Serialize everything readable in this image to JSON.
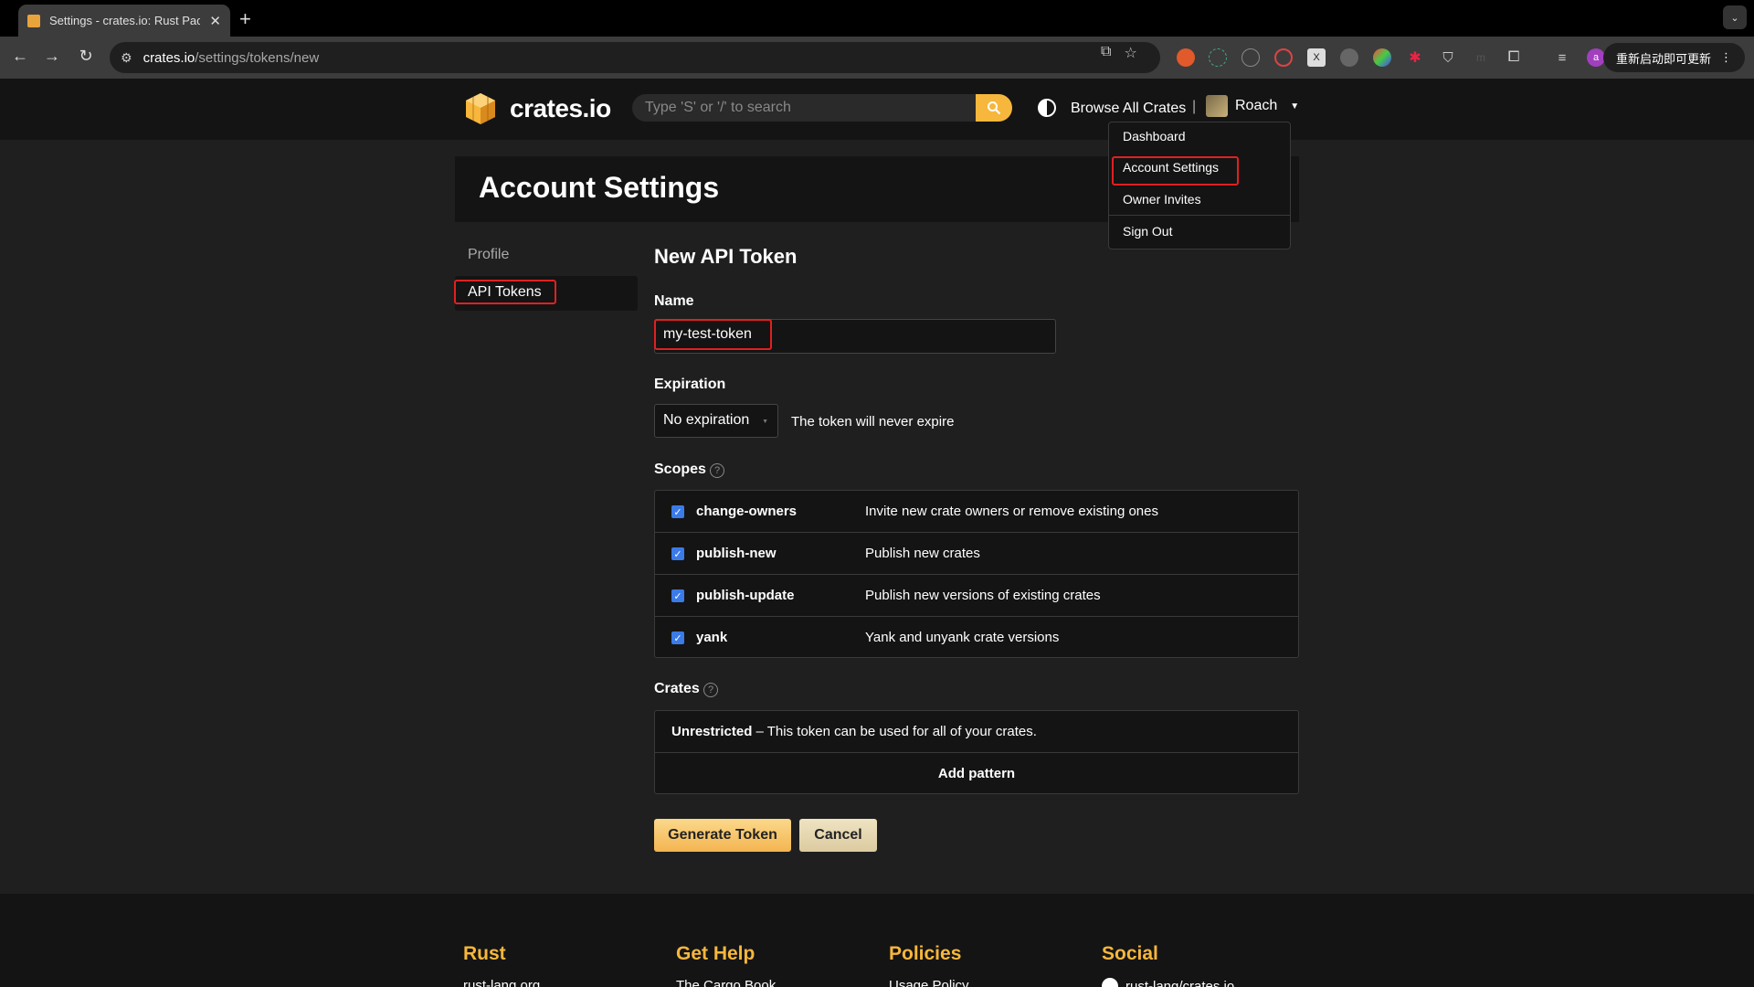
{
  "browser": {
    "tab_title": "Settings - crates.io: Rust Package Registry",
    "url_host": "crates.io",
    "url_path": "/settings/tokens/new",
    "update_label": "重新启动即可更新"
  },
  "header": {
    "logo_text": "crates.io",
    "search_placeholder": "Type 'S' or '/' to search",
    "browse_label": "Browse All Crates",
    "separator": "|",
    "username": "Roach"
  },
  "dropdown": {
    "items": [
      "Dashboard",
      "Account Settings",
      "Owner Invites",
      "Sign Out"
    ]
  },
  "page": {
    "title": "Account Settings"
  },
  "sidebar": {
    "items": [
      "Profile",
      "API Tokens"
    ]
  },
  "form": {
    "title": "New API Token",
    "name_label": "Name",
    "name_value": "my-test-token",
    "expiration_label": "Expiration",
    "expiration_value": "No expiration",
    "expiration_note": "The token will never expire",
    "scopes_label": "Scopes",
    "scopes": [
      {
        "name": "change-owners",
        "desc": "Invite new crate owners or remove existing ones"
      },
      {
        "name": "publish-new",
        "desc": "Publish new crates"
      },
      {
        "name": "publish-update",
        "desc": "Publish new versions of existing crates"
      },
      {
        "name": "yank",
        "desc": "Yank and unyank crate versions"
      }
    ],
    "crates_label": "Crates",
    "crates_unrestricted": "Unrestricted",
    "crates_note": " – This token can be used for all of your crates.",
    "add_pattern": "Add pattern",
    "generate_label": "Generate Token",
    "cancel_label": "Cancel"
  },
  "footer": {
    "columns": [
      "Rust",
      "Get Help",
      "Policies",
      "Social"
    ],
    "links": [
      "rust-lang.org",
      "The Cargo Book",
      "Usage Policy",
      "rust-lang/crates.io"
    ]
  },
  "colors": {
    "accent": "#f6b73c",
    "highlight": "#e02020",
    "checkbox": "#3b7be8"
  }
}
